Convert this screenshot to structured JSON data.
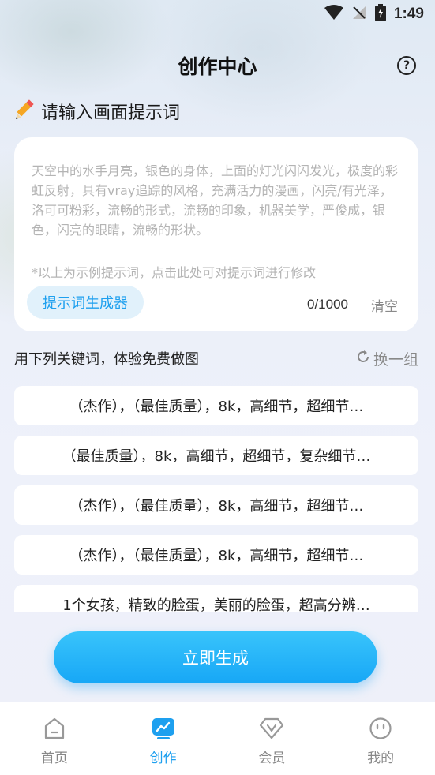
{
  "status_bar": {
    "time": "1:49"
  },
  "header": {
    "title": "创作中心",
    "help_symbol": "?"
  },
  "prompt": {
    "heading": "请输入画面提示词",
    "heading_icon": "pencil-icon",
    "example_text": "天空中的水手月亮，银色的身体，上面的灯光闪闪发光，极度的彩虹反射，具有vray追踪的风格，充满活力的漫画，闪亮/有光泽，洛可可粉彩，流畅的形式，流畅的印象，机器美学，严俊成，银色，闪亮的眼睛，流畅的形状。",
    "note": "*以上为示例提示词，点击此处可对提示词进行修改",
    "generator_button": "提示词生成器",
    "char_count": "0/1000",
    "clear_label": "清空"
  },
  "keywords": {
    "title": "用下列关键词，体验免费做图",
    "refresh_label": "换一组",
    "items": [
      "（杰作），（最佳质量），8k，高细节，超细节…",
      "（最佳质量），8k，高细节，超细节，复杂细节…",
      "（杰作），（最佳质量），8k，高细节，超细节…",
      "（杰作），（最佳质量），8k，高细节，超细节…",
      "1个女孩，精致的脸蛋，美丽的脸蛋，超高分辨…"
    ]
  },
  "generate_button": "立即生成",
  "tabs": [
    {
      "label": "首页",
      "icon": "home-icon"
    },
    {
      "label": "创作",
      "icon": "create-icon",
      "active": true
    },
    {
      "label": "会员",
      "icon": "vip-icon"
    },
    {
      "label": "我的",
      "icon": "profile-icon"
    }
  ],
  "colors": {
    "accent": "#1ea0ef",
    "button_gradient_top": "#39c4fb",
    "button_gradient_bottom": "#17a7f6"
  }
}
